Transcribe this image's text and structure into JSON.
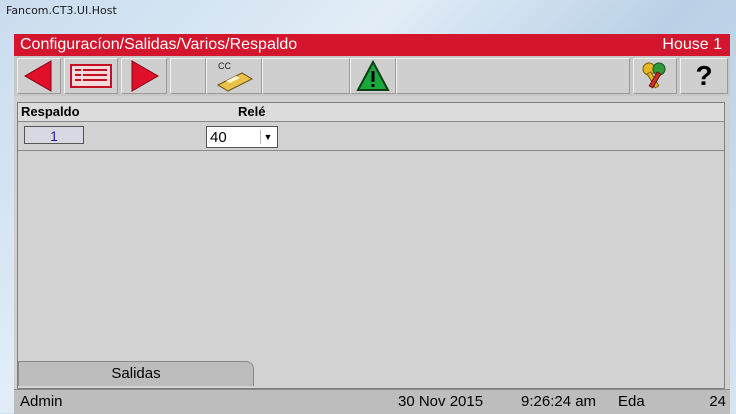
{
  "window": {
    "title": "Fancom.CT3.UI.Host"
  },
  "header": {
    "path": "Configuracíon/Salidas/Varios/Respaldo",
    "house": "House 1"
  },
  "toolbar": {
    "cc_label": "CC",
    "help_label": "?"
  },
  "table": {
    "columns": [
      "Respaldo",
      "Relé"
    ],
    "rows": [
      {
        "respaldo": "1",
        "rele": "40"
      }
    ]
  },
  "tabs": [
    {
      "label": "Salidas"
    }
  ],
  "status": {
    "user": "Admin",
    "date": "30 Nov 2015",
    "time": "9:26:24 am",
    "flag": "Eda",
    "value": "24"
  },
  "colors": {
    "header_red": "#d3162d",
    "arrow_red": "#e0102a",
    "warning_green": "#1aa83a"
  }
}
